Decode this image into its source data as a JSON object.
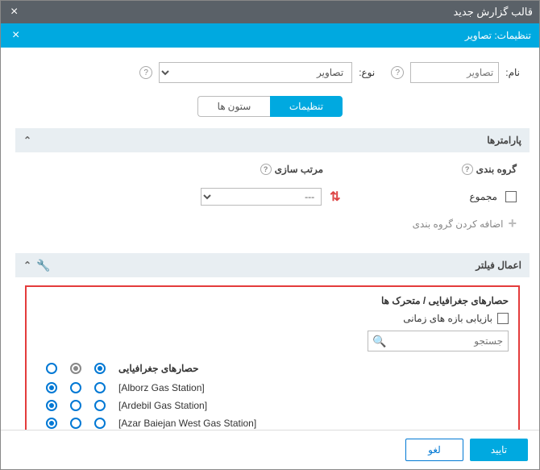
{
  "outer": {
    "title": "قالب گزارش جدید"
  },
  "inner": {
    "title": "تنظیمات: تصاویر"
  },
  "form": {
    "name_label": "نام:",
    "name_value": "تصاویر",
    "type_label": "نوع:",
    "type_value": "تصاویر"
  },
  "tabs": {
    "settings": "تنظیمات",
    "columns": "ستون ها"
  },
  "params": {
    "header": "پارامترها",
    "group_label": "گروه بندی",
    "sort_label": "مرتب سازی",
    "group_value": "مجموع",
    "sort_value": "---",
    "add_group": "اضافه کردن گروه بندی"
  },
  "filters": {
    "header": "اعمال فیلتر",
    "sub_title": "حصارهای جغرافیایی / متحرک ها",
    "retrieve_label": "بازیابی بازه های زمانی",
    "search_placeholder": "جستجو",
    "geo_header": "حصارهای جغرافیایی",
    "rows": [
      "[Alborz Gas Station]",
      "[Ardebil Gas Station]",
      "[Azar Baiejan West Gas Station]"
    ]
  },
  "footer": {
    "ok": "تایید",
    "cancel": "لغو"
  },
  "help": "?"
}
